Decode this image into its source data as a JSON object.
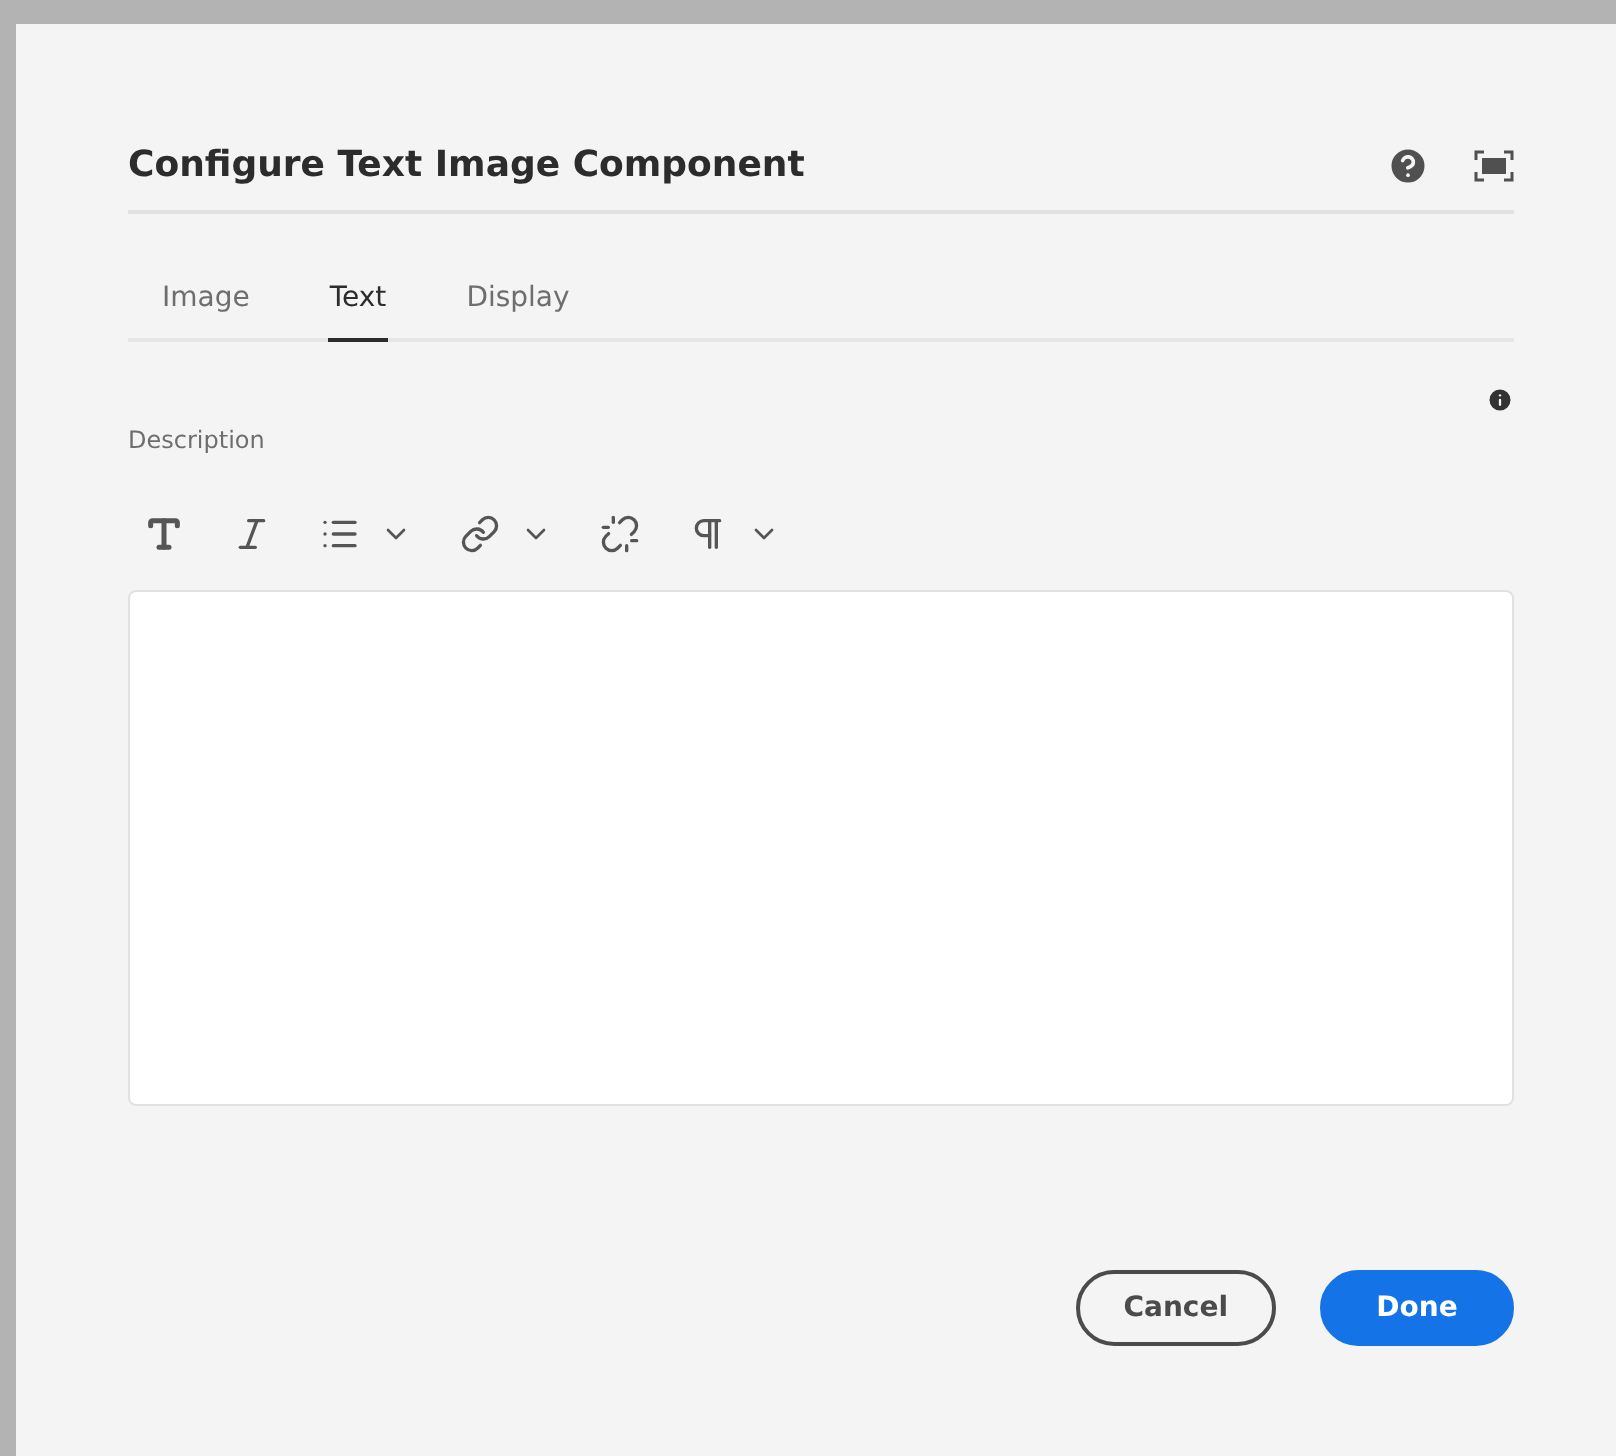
{
  "dialog": {
    "title": "Configure Text Image Component"
  },
  "tabs": [
    {
      "label": "Image",
      "selected": false
    },
    {
      "label": "Text",
      "selected": true
    },
    {
      "label": "Display",
      "selected": false
    }
  ],
  "field": {
    "label": "Description"
  },
  "toolbar": [
    {
      "kind": "bold",
      "dropdown": false
    },
    {
      "kind": "italic",
      "dropdown": false
    },
    {
      "kind": "list",
      "dropdown": true
    },
    {
      "kind": "link",
      "dropdown": true
    },
    {
      "kind": "unlink",
      "dropdown": false
    },
    {
      "kind": "paragraph",
      "dropdown": true
    }
  ],
  "buttons": [
    {
      "label": "Cancel",
      "kind": "secondary"
    },
    {
      "label": "Done",
      "kind": "primary"
    }
  ]
}
